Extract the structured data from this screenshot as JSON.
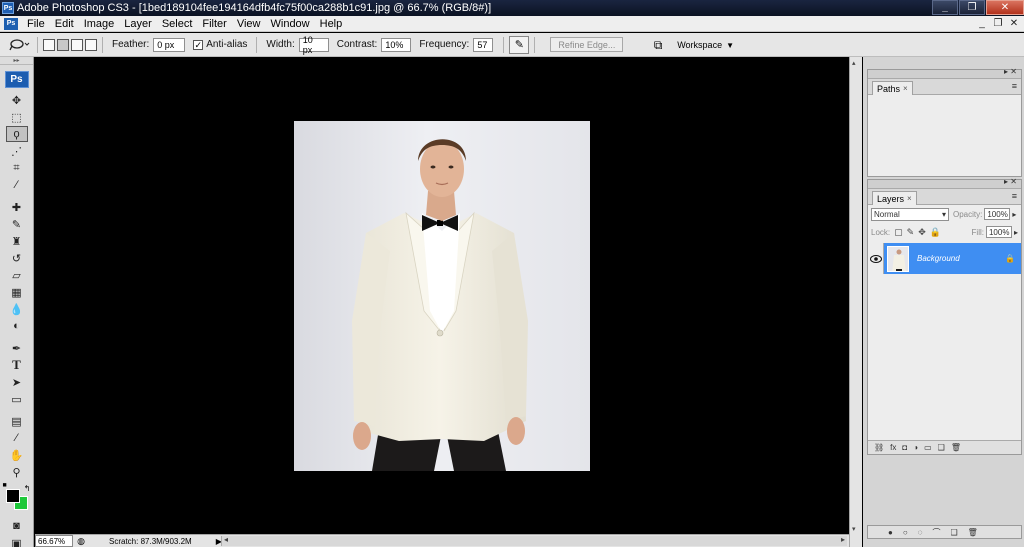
{
  "window": {
    "title": "Adobe Photoshop CS3 - [1bed189104fee194164dfb4fc75f00ca288b1c91.jpg @ 66.7% (RGB/8#)]",
    "app_badge": "Ps",
    "minimize": "_",
    "restore": "❐",
    "close": "✕"
  },
  "menu": {
    "badge": "Ps",
    "items": [
      "File",
      "Edit",
      "Image",
      "Layer",
      "Select",
      "Filter",
      "View",
      "Window",
      "Help"
    ],
    "doc_min": "_",
    "doc_restore": "❐",
    "doc_close": "✕"
  },
  "options": {
    "feather_label": "Feather:",
    "feather_value": "0 px",
    "antialias_label": "Anti-alias",
    "antialias_checked": "✓",
    "width_label": "Width:",
    "width_value": "10 px",
    "contrast_label": "Contrast:",
    "contrast_value": "10%",
    "frequency_label": "Frequency:",
    "frequency_value": "57",
    "refine_label": "Refine Edge...",
    "workspace_label": "Workspace",
    "workspace_caret": "▼"
  },
  "tools": {
    "logo": "Ps"
  },
  "status": {
    "zoom": "66.67%",
    "scratch": "Scratch: 87.3M/903.2M",
    "arrow": "▶"
  },
  "paths_panel": {
    "tab_label": "Paths",
    "close": "×"
  },
  "layers_panel": {
    "tab_label": "Layers",
    "close": "×",
    "blend_mode": "Normal",
    "opacity_label": "Opacity:",
    "opacity_value": "100%",
    "lock_label": "Lock:",
    "fill_label": "Fill:",
    "fill_value": "100%",
    "layer_name": "Background",
    "layer_visible": "👁"
  },
  "colors": {
    "foreground": "#000000",
    "background": "#1ec83a",
    "selection_blue": "#3f8ef2"
  }
}
